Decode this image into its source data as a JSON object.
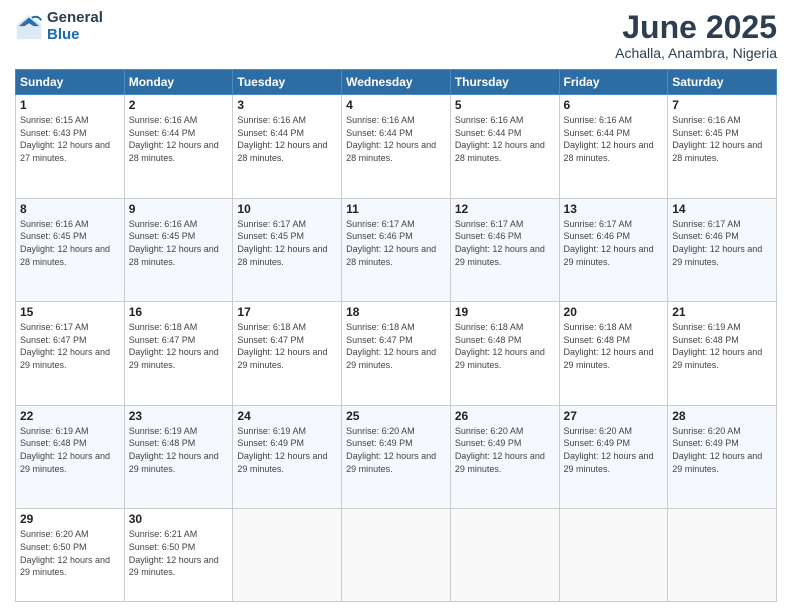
{
  "logo": {
    "general": "General",
    "blue": "Blue"
  },
  "title": "June 2025",
  "subtitle": "Achalla, Anambra, Nigeria",
  "days_header": [
    "Sunday",
    "Monday",
    "Tuesday",
    "Wednesday",
    "Thursday",
    "Friday",
    "Saturday"
  ],
  "weeks": [
    [
      {
        "day": "1",
        "sunrise": "6:15 AM",
        "sunset": "6:43 PM",
        "daylight": "12 hours and 27 minutes."
      },
      {
        "day": "2",
        "sunrise": "6:16 AM",
        "sunset": "6:44 PM",
        "daylight": "12 hours and 28 minutes."
      },
      {
        "day": "3",
        "sunrise": "6:16 AM",
        "sunset": "6:44 PM",
        "daylight": "12 hours and 28 minutes."
      },
      {
        "day": "4",
        "sunrise": "6:16 AM",
        "sunset": "6:44 PM",
        "daylight": "12 hours and 28 minutes."
      },
      {
        "day": "5",
        "sunrise": "6:16 AM",
        "sunset": "6:44 PM",
        "daylight": "12 hours and 28 minutes."
      },
      {
        "day": "6",
        "sunrise": "6:16 AM",
        "sunset": "6:44 PM",
        "daylight": "12 hours and 28 minutes."
      },
      {
        "day": "7",
        "sunrise": "6:16 AM",
        "sunset": "6:45 PM",
        "daylight": "12 hours and 28 minutes."
      }
    ],
    [
      {
        "day": "8",
        "sunrise": "6:16 AM",
        "sunset": "6:45 PM",
        "daylight": "12 hours and 28 minutes."
      },
      {
        "day": "9",
        "sunrise": "6:16 AM",
        "sunset": "6:45 PM",
        "daylight": "12 hours and 28 minutes."
      },
      {
        "day": "10",
        "sunrise": "6:17 AM",
        "sunset": "6:45 PM",
        "daylight": "12 hours and 28 minutes."
      },
      {
        "day": "11",
        "sunrise": "6:17 AM",
        "sunset": "6:46 PM",
        "daylight": "12 hours and 28 minutes."
      },
      {
        "day": "12",
        "sunrise": "6:17 AM",
        "sunset": "6:46 PM",
        "daylight": "12 hours and 29 minutes."
      },
      {
        "day": "13",
        "sunrise": "6:17 AM",
        "sunset": "6:46 PM",
        "daylight": "12 hours and 29 minutes."
      },
      {
        "day": "14",
        "sunrise": "6:17 AM",
        "sunset": "6:46 PM",
        "daylight": "12 hours and 29 minutes."
      }
    ],
    [
      {
        "day": "15",
        "sunrise": "6:17 AM",
        "sunset": "6:47 PM",
        "daylight": "12 hours and 29 minutes."
      },
      {
        "day": "16",
        "sunrise": "6:18 AM",
        "sunset": "6:47 PM",
        "daylight": "12 hours and 29 minutes."
      },
      {
        "day": "17",
        "sunrise": "6:18 AM",
        "sunset": "6:47 PM",
        "daylight": "12 hours and 29 minutes."
      },
      {
        "day": "18",
        "sunrise": "6:18 AM",
        "sunset": "6:47 PM",
        "daylight": "12 hours and 29 minutes."
      },
      {
        "day": "19",
        "sunrise": "6:18 AM",
        "sunset": "6:48 PM",
        "daylight": "12 hours and 29 minutes."
      },
      {
        "day": "20",
        "sunrise": "6:18 AM",
        "sunset": "6:48 PM",
        "daylight": "12 hours and 29 minutes."
      },
      {
        "day": "21",
        "sunrise": "6:19 AM",
        "sunset": "6:48 PM",
        "daylight": "12 hours and 29 minutes."
      }
    ],
    [
      {
        "day": "22",
        "sunrise": "6:19 AM",
        "sunset": "6:48 PM",
        "daylight": "12 hours and 29 minutes."
      },
      {
        "day": "23",
        "sunrise": "6:19 AM",
        "sunset": "6:48 PM",
        "daylight": "12 hours and 29 minutes."
      },
      {
        "day": "24",
        "sunrise": "6:19 AM",
        "sunset": "6:49 PM",
        "daylight": "12 hours and 29 minutes."
      },
      {
        "day": "25",
        "sunrise": "6:20 AM",
        "sunset": "6:49 PM",
        "daylight": "12 hours and 29 minutes."
      },
      {
        "day": "26",
        "sunrise": "6:20 AM",
        "sunset": "6:49 PM",
        "daylight": "12 hours and 29 minutes."
      },
      {
        "day": "27",
        "sunrise": "6:20 AM",
        "sunset": "6:49 PM",
        "daylight": "12 hours and 29 minutes."
      },
      {
        "day": "28",
        "sunrise": "6:20 AM",
        "sunset": "6:49 PM",
        "daylight": "12 hours and 29 minutes."
      }
    ],
    [
      {
        "day": "29",
        "sunrise": "6:20 AM",
        "sunset": "6:50 PM",
        "daylight": "12 hours and 29 minutes."
      },
      {
        "day": "30",
        "sunrise": "6:21 AM",
        "sunset": "6:50 PM",
        "daylight": "12 hours and 29 minutes."
      },
      null,
      null,
      null,
      null,
      null
    ]
  ]
}
